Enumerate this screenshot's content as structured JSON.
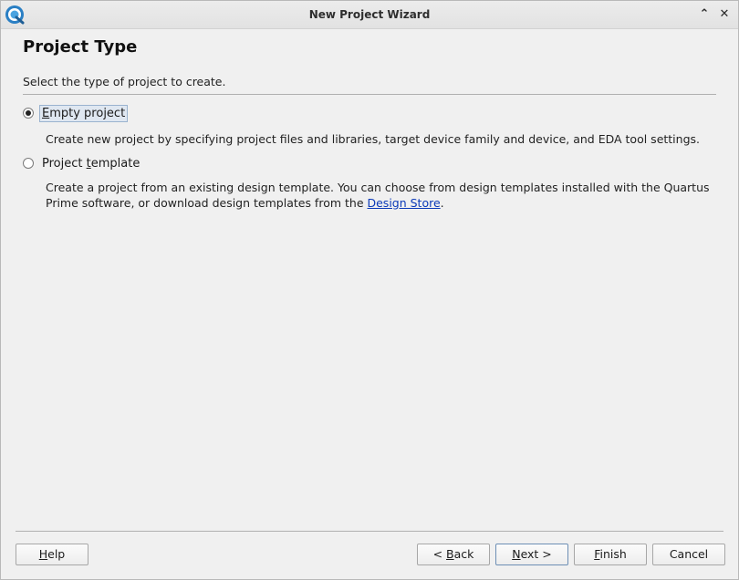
{
  "window": {
    "title": "New Project Wizard"
  },
  "page": {
    "title": "Project Type",
    "subtitle": "Select the type of project to create."
  },
  "options": [
    {
      "label_pre": "",
      "label_mnemonic": "E",
      "label_post": "mpty project",
      "selected": true,
      "description": "Create new project by specifying project files and libraries, target device family and device, and EDA tool settings."
    },
    {
      "label_pre": "Project ",
      "label_mnemonic": "t",
      "label_post": "emplate",
      "selected": false,
      "description_part1": "Create a project from an existing design template. You can choose from design templates installed with the Quartus Prime software, or download design templates from the ",
      "link_text": "Design Store",
      "description_part2": "."
    }
  ],
  "buttons": {
    "help": {
      "mnemonic": "H",
      "rest": "elp"
    },
    "back": {
      "pre": "< ",
      "mnemonic": "B",
      "rest": "ack"
    },
    "next": {
      "mnemonic": "N",
      "rest": "ext >"
    },
    "finish": {
      "mnemonic": "F",
      "rest": "inish"
    },
    "cancel": {
      "label": "Cancel"
    }
  },
  "icons": {
    "app": "quartus-app-icon",
    "collapse": "chevron-up-icon",
    "close": "close-icon"
  }
}
